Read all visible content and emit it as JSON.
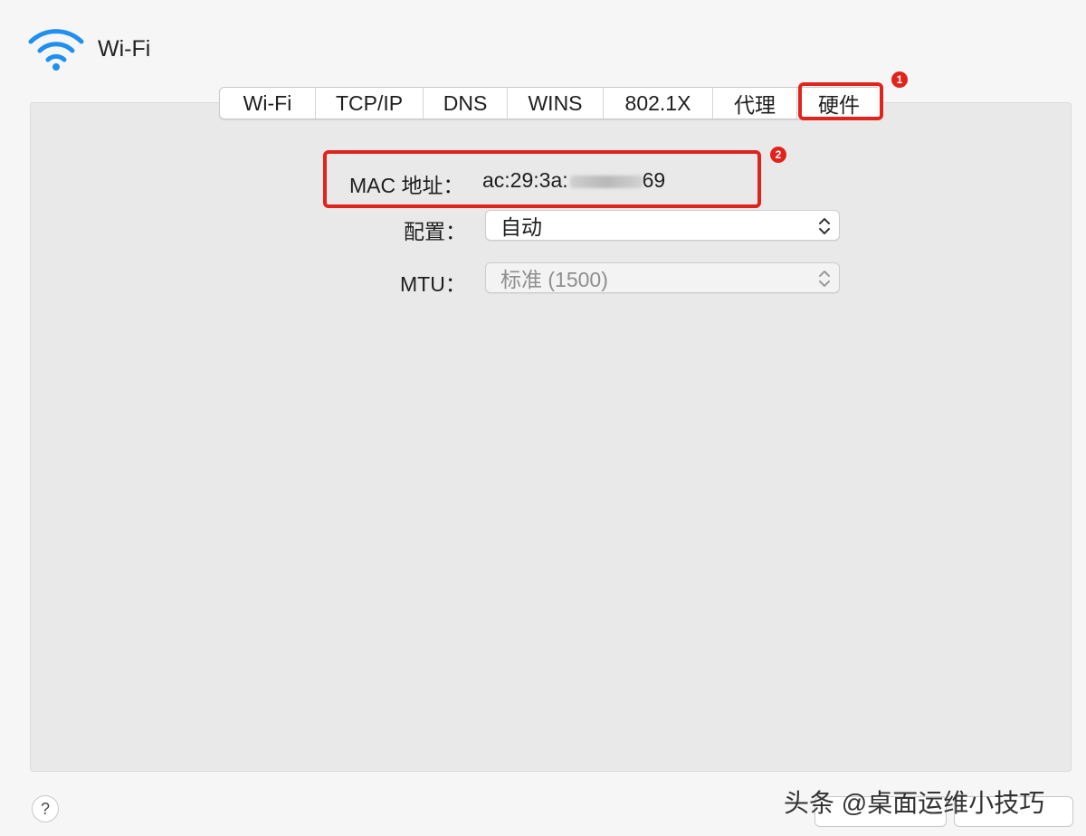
{
  "window": {
    "title": "Wi-Fi",
    "icon": "wifi-icon"
  },
  "tabs": [
    {
      "label": "Wi-Fi"
    },
    {
      "label": "TCP/IP"
    },
    {
      "label": "DNS"
    },
    {
      "label": "WINS"
    },
    {
      "label": "802.1X"
    },
    {
      "label": "代理"
    },
    {
      "label": "硬件",
      "active": true
    }
  ],
  "annotations": {
    "badge1": "1",
    "badge2": "2"
  },
  "hardware": {
    "mac_label": "MAC 地址：",
    "mac_value_start": "ac:29:3a:",
    "mac_value_end": "69",
    "config_label": "配置：",
    "config_value": "自动",
    "mtu_label": "MTU：",
    "mtu_value": "标准 (1500)"
  },
  "footer": {
    "help_label": "?"
  },
  "watermark": {
    "text": "头条 @桌面运维小技巧"
  },
  "colors": {
    "highlight": "#e0241b",
    "wifi_blue": "#1f8ff0"
  }
}
